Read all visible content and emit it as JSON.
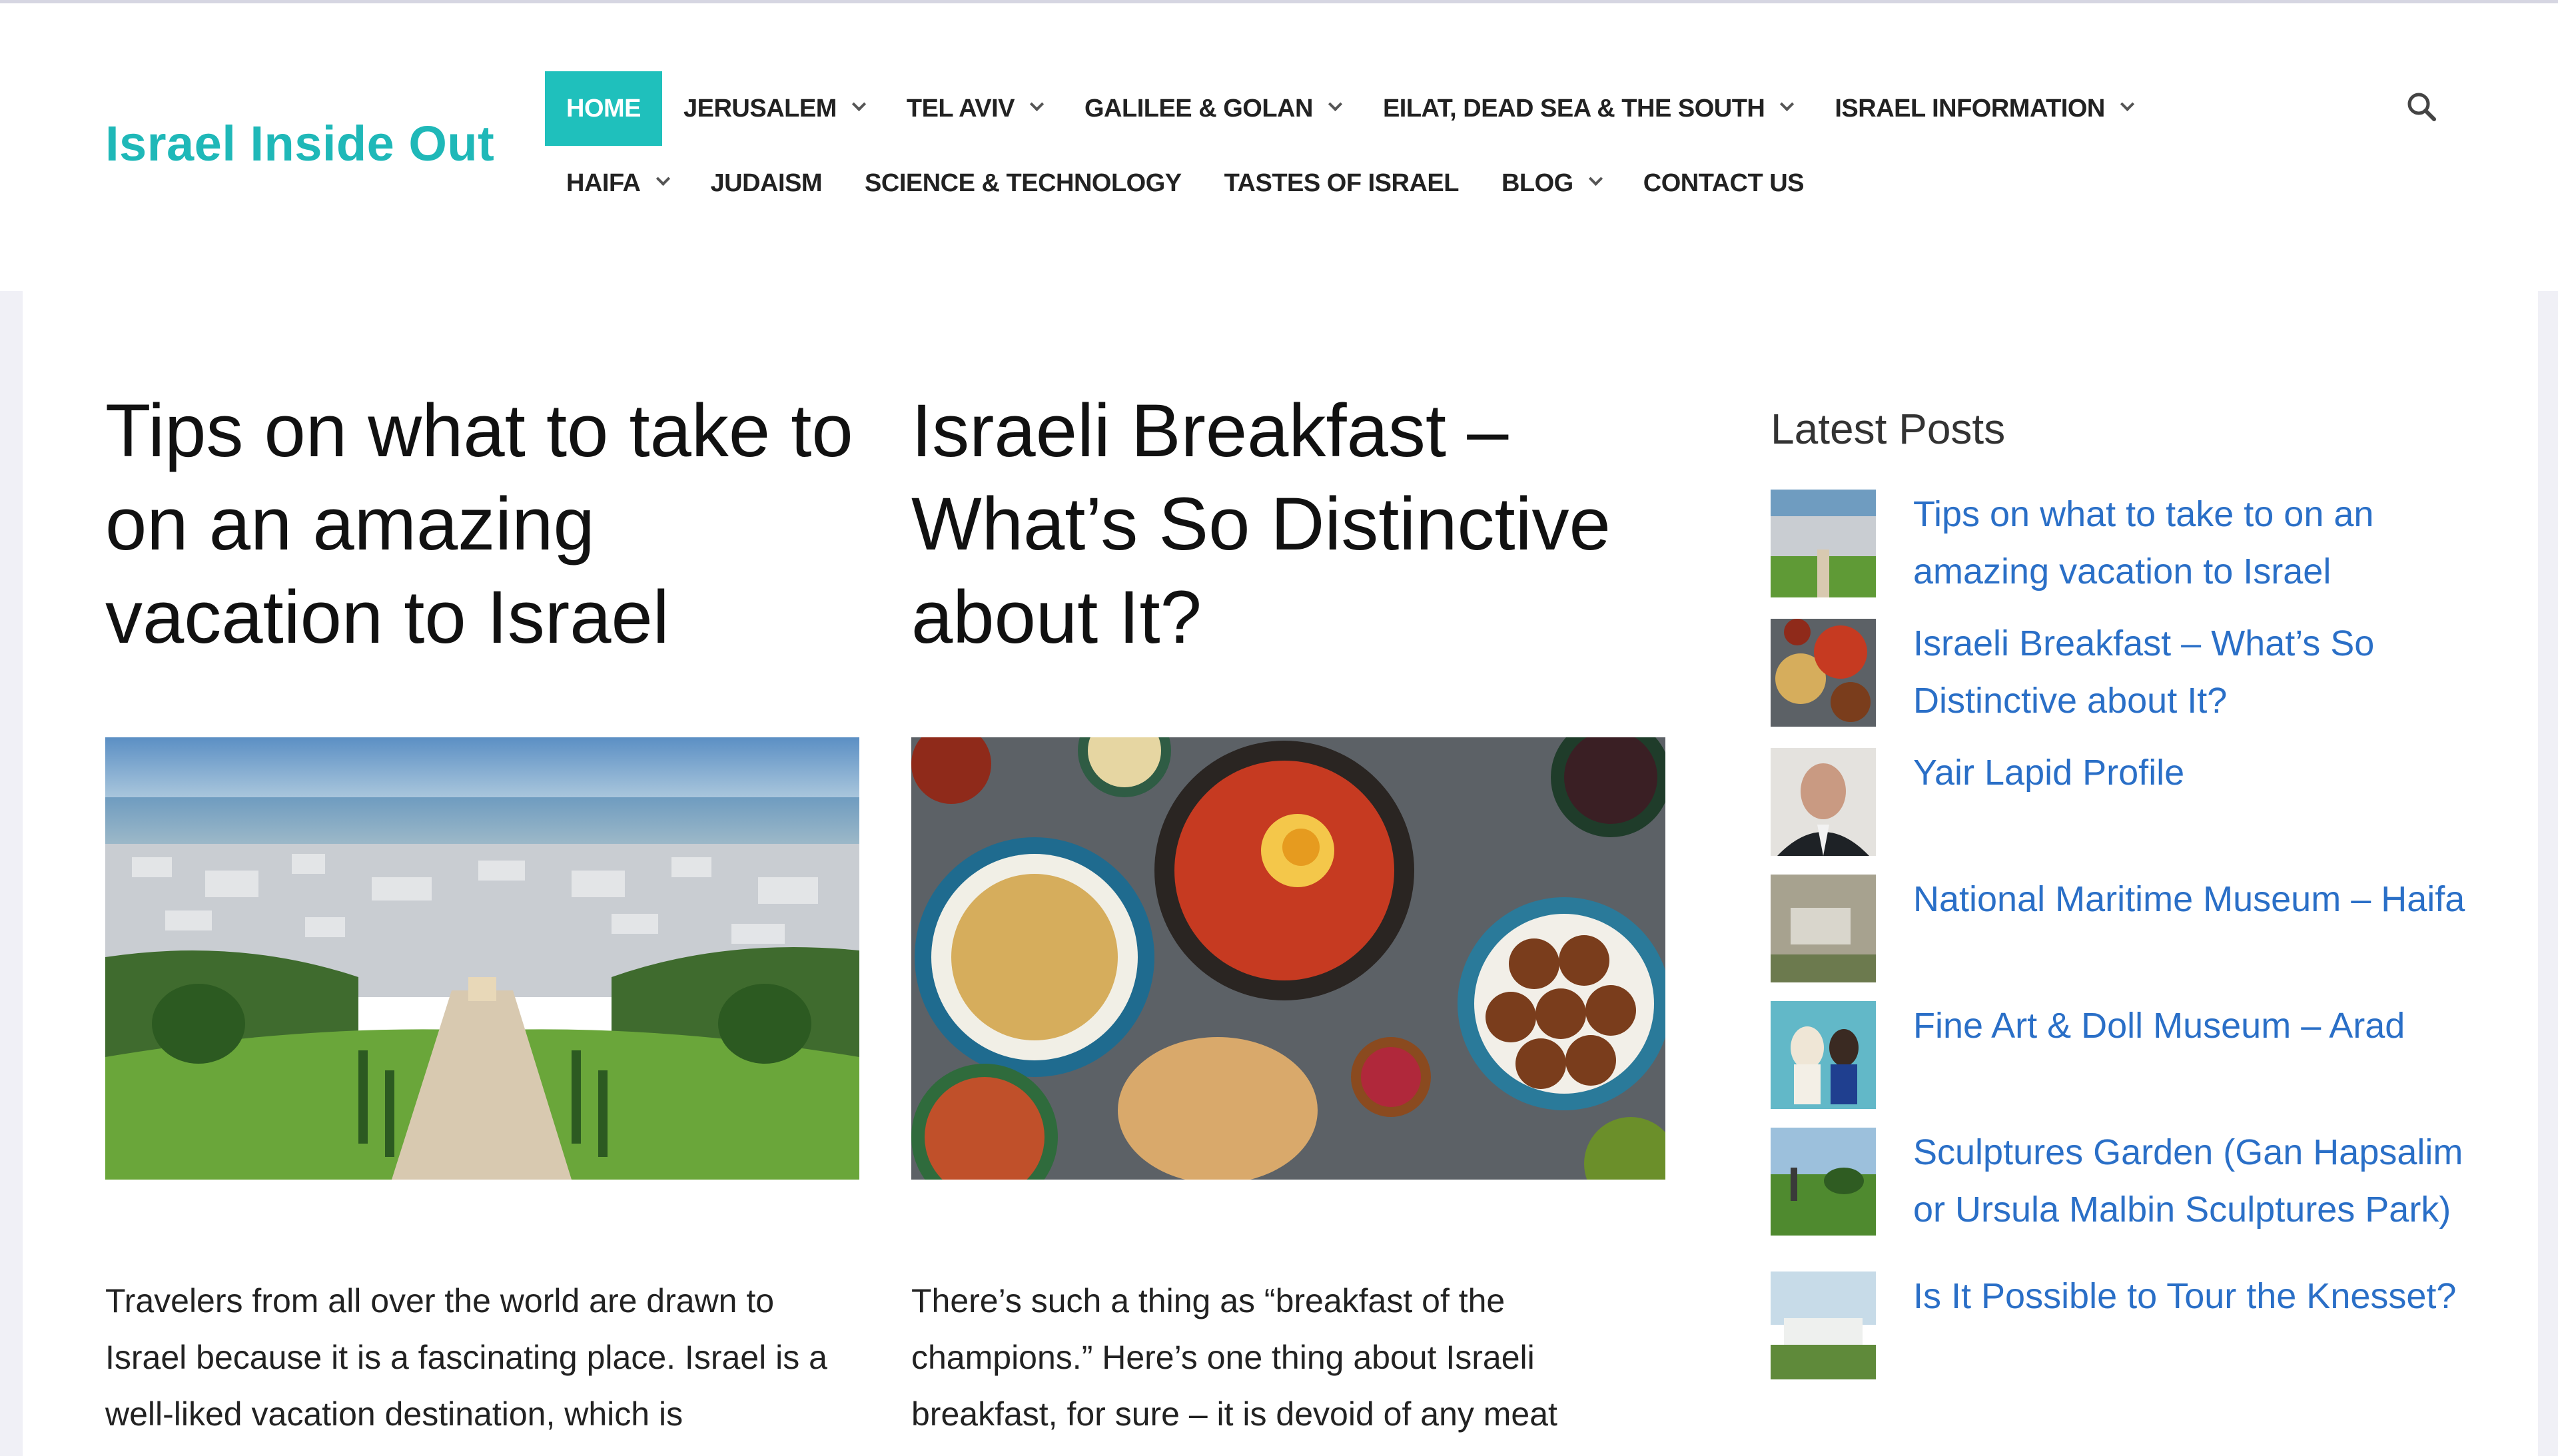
{
  "site": {
    "logo": "Israel Inside Out"
  },
  "nav": {
    "row1": [
      {
        "label": "HOME",
        "active": true,
        "dropdown": false
      },
      {
        "label": "JERUSALEM",
        "active": false,
        "dropdown": true
      },
      {
        "label": "TEL AVIV",
        "active": false,
        "dropdown": true
      },
      {
        "label": "GALILEE & GOLAN",
        "active": false,
        "dropdown": true
      },
      {
        "label": "EILAT, DEAD SEA & THE SOUTH",
        "active": false,
        "dropdown": true
      },
      {
        "label": "ISRAEL INFORMATION",
        "active": false,
        "dropdown": true
      }
    ],
    "row2": [
      {
        "label": "HAIFA",
        "active": false,
        "dropdown": true
      },
      {
        "label": "JUDAISM",
        "active": false,
        "dropdown": false
      },
      {
        "label": "SCIENCE & TECHNOLOGY",
        "active": false,
        "dropdown": false
      },
      {
        "label": "TASTES OF ISRAEL",
        "active": false,
        "dropdown": false
      },
      {
        "label": "BLOG",
        "active": false,
        "dropdown": true
      },
      {
        "label": "CONTACT US",
        "active": false,
        "dropdown": false
      }
    ],
    "search_icon": "search-icon"
  },
  "posts": [
    {
      "title": "Tips on what to take to on an amazing vacation to Israel",
      "excerpt": "Travelers from all over the world are drawn to Israel because it is a fascinating place. Israel is a well-liked vacation destination, which is",
      "image": "haifa-bahai-gardens"
    },
    {
      "title": "Israeli Breakfast – What’s So Distinctive about It?",
      "excerpt": "There’s such a thing as “breakfast of the champions.” Here’s one thing about Israeli breakfast, for sure – it is devoid of any meat",
      "image": "israeli-breakfast-spread"
    }
  ],
  "sidebar": {
    "title": "Latest Posts",
    "items": [
      {
        "label": "Tips on what to take to on an amazing vacation to Israel",
        "thumb": "haifa-view"
      },
      {
        "label": "Israeli Breakfast – What’s So Distinctive about It?",
        "thumb": "breakfast"
      },
      {
        "label": "Yair Lapid Profile",
        "thumb": "portrait"
      },
      {
        "label": "National Maritime Museum – Haifa",
        "thumb": "museum-aerial"
      },
      {
        "label": "Fine Art & Doll Museum – Arad",
        "thumb": "dolls"
      },
      {
        "label": "Sculptures Garden (Gan Hapsalim or Ursula Malbin Sculptures Park)",
        "thumb": "garden"
      },
      {
        "label": "Is It Possible to Tour the Knesset?",
        "thumb": "knesset"
      }
    ]
  }
}
